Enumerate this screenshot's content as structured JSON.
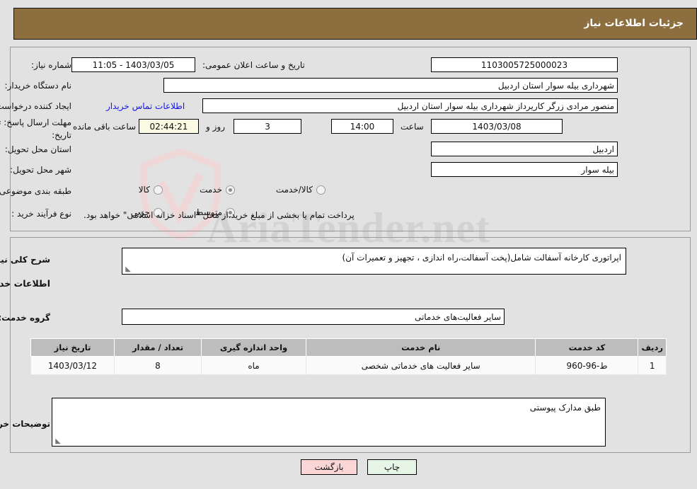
{
  "header": {
    "title": "جزئیات اطلاعات نیاز"
  },
  "top_form": {
    "need_number_label": "شماره نیاز:",
    "need_number_value": "1103005725000023",
    "public_announce_label": "تاریخ و ساعت اعلان عمومی:",
    "public_announce_value": "1403/03/05 - 11:05",
    "buyer_org_label": "نام دستگاه خریدار:",
    "buyer_org_value": "شهرداری بیله سوار استان اردبیل",
    "creator_label": "ایجاد کننده درخواست:",
    "creator_value": "منصور مرادی زرگر کاریرداز شهرداری بیله سوار استان اردبیل",
    "contact_link": "اطلاعات تماس خریدار",
    "deadline_label_line1": "مهلت ارسال پاسخ: تا",
    "deadline_label_line2": "تاریخ:",
    "deadline_date": "1403/03/08",
    "hour_label": "ساعت",
    "deadline_time": "14:00",
    "days_remaining": "3",
    "days_label": "روز و",
    "time_remaining": "02:44:21",
    "remaining_suffix": "ساعت باقی مانده",
    "province_label": "استان محل تحویل:",
    "province_value": "اردبیل",
    "city_label": "شهر محل تحویل:",
    "city_value": "بیله سوار",
    "category_label": "طبقه بندی موضوعی:",
    "category_options": [
      {
        "label": "کالا",
        "selected": false
      },
      {
        "label": "خدمت",
        "selected": true
      },
      {
        "label": "کالا/خدمت",
        "selected": false
      }
    ],
    "process_label": "نوع فرآیند خرید :",
    "process_options": [
      {
        "label": "جزیی",
        "selected": false
      },
      {
        "label": "متوسط",
        "selected": true
      }
    ],
    "payment_note": "پرداخت تمام یا بخشی از مبلغ خرید،از محل \"اسناد خزانه اسلامی\" خواهد بود."
  },
  "bottom_form": {
    "general_desc_label": "شرح کلی نیاز:",
    "general_desc_value": "اپراتوری کارخانه آسفالت شامل(پخت آسفالت،راه اندازی ، تجهیز و تعمیرات آن)",
    "services_section_title": "اطلاعات خدمات مورد نیاز",
    "service_group_label": "گروه خدمت:",
    "service_group_value": "سایر فعالیت‌های خدماتی",
    "table": {
      "columns": [
        "ردیف",
        "کد خدمت",
        "نام خدمت",
        "واحد اندازه گیری",
        "تعداد / مقدار",
        "تاریخ نیاز"
      ],
      "rows": [
        {
          "row": "1",
          "code": "ط-96-960",
          "name": "سایر فعالیت های خدماتی شخصی",
          "unit": "ماه",
          "quantity": "8",
          "need_date": "1403/03/12"
        }
      ]
    },
    "buyer_notes_label": "توضیحات خریدار:",
    "buyer_notes_value": "طبق مدارک پیوستی"
  },
  "footer": {
    "print_label": "چاپ",
    "back_label": "بازگشت"
  },
  "watermark": {
    "text": "AriaTender.net"
  },
  "colors": {
    "header_bg": "#8d6e3f",
    "page_bg": "#e2e2e2",
    "link": "#1414e6",
    "table_header_bg": "#bdbdbd",
    "print_btn_bg": "#e6f5e6",
    "back_btn_bg": "#fbd6d6",
    "countdown_bg": "#fbfbe4"
  }
}
